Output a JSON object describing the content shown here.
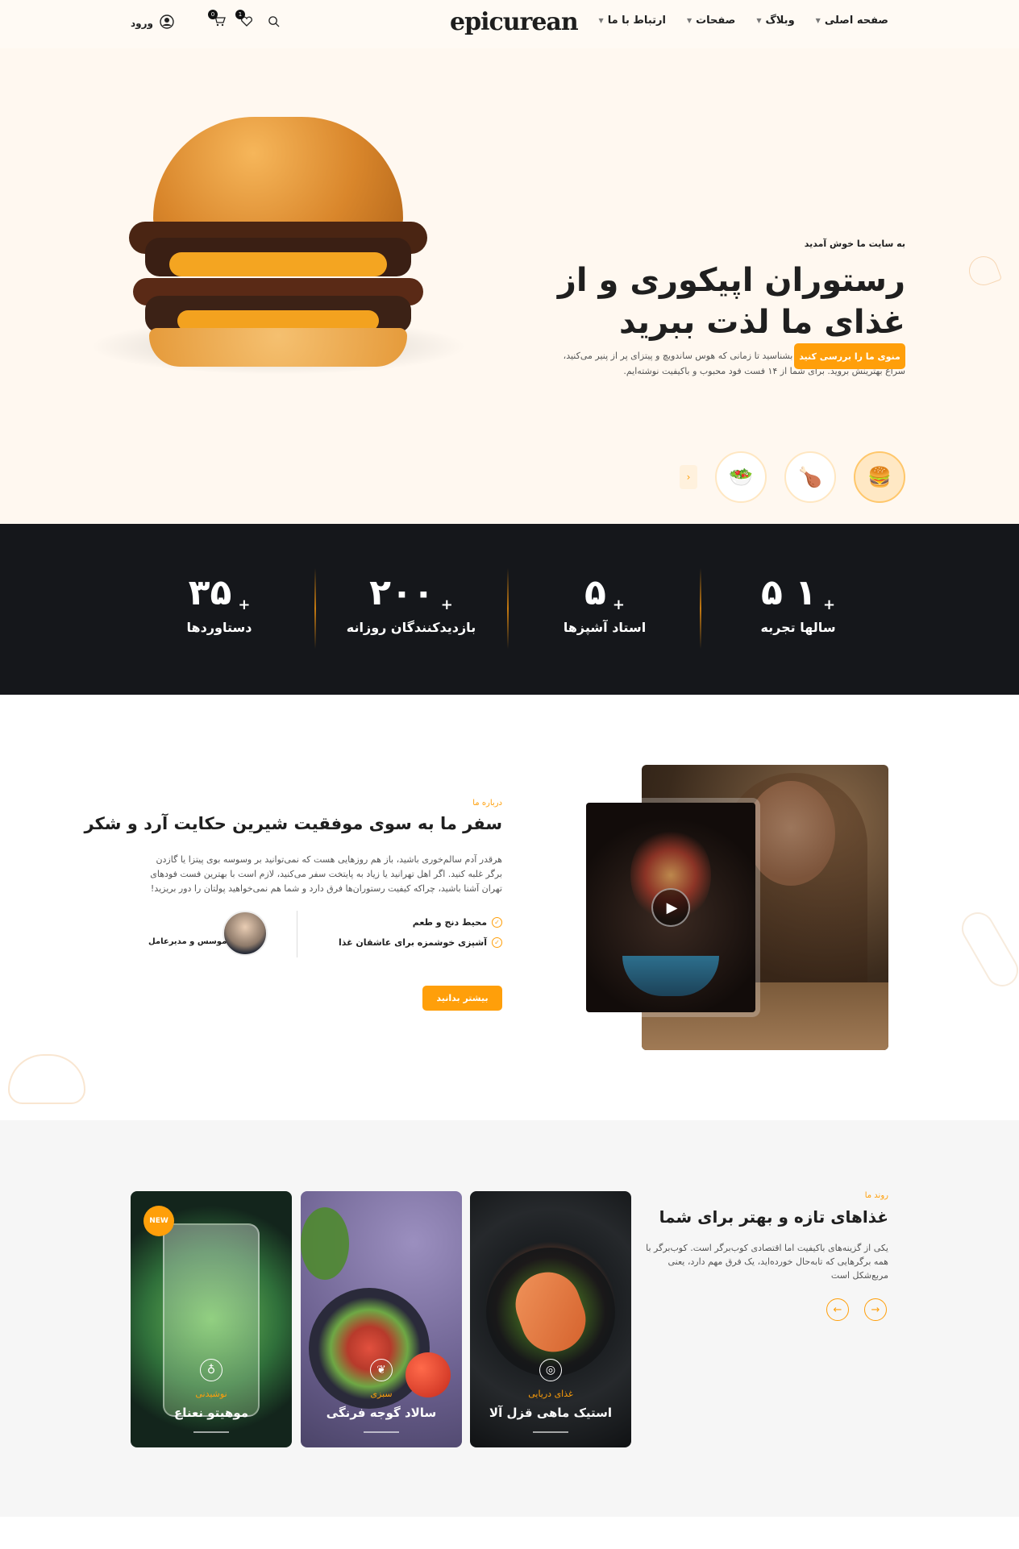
{
  "header": {
    "logo": "epicurean",
    "nav": [
      {
        "label": "صفحه اصلی"
      },
      {
        "label": "وبلاگ"
      },
      {
        "label": "صفحات"
      },
      {
        "label": "ارتباط با ما"
      }
    ],
    "cart_count": "0",
    "wishlist_count": "1",
    "login_label": "ورود"
  },
  "hero": {
    "subtitle": "به سایت ما خوش آمدید",
    "title": "رستوران اپیکوری و از غذای ما لذت ببرید",
    "description": "بهترین فست فودهای تهران را بشناسید تا زمانی که هوس ساندویچ و پیتزای پر از پنیر می‌کنید، سراغ بهترینش بروید. برای شما از ۱۴ فست فود محبوب و باکیفیت نوشته‌ایم.",
    "cta": "منوی ما را بررسی کنید"
  },
  "stats": [
    {
      "value": "۱ ۵",
      "label": "سالها تجربه"
    },
    {
      "value": "۵",
      "label": "استاد آشپزها"
    },
    {
      "value": "۲۰۰",
      "label": "بازدیدکنندگان روزانه"
    },
    {
      "value": "۳۵",
      "label": "دستاوردها"
    }
  ],
  "about": {
    "eyebrow": "درباره ما",
    "title": "سفر ما به سوی موفقیت شیرین حکایت آرد و شکر",
    "description": "هرقدر آدم سالم‌خوری باشید، باز هم روزهایی هست که نمی‌توانید بر وسوسه بوی پیتزا یا گازدن برگر غلبه کنید. اگر اهل تهرانید یا زیاد به پایتخت سفر می‌کنید، لازم است با بهترین فست فودهای تهران آشنا باشید، چراکه کیفیت رستوران‌ها فرق دارد و شما هم نمی‌خواهید پولتان را دور بریزید!",
    "features": [
      "محیط دنج و طعم",
      "آشپزی خوشمزه برای عاشقان غذا"
    ],
    "founder_role": "موسس و مدیرعامل",
    "cta": "بیشتر بدانید"
  },
  "menu": {
    "eyebrow": "روند ما",
    "title": "غذاهای تازه و بهتر برای شما",
    "description": "یکی از گزینه‌های باکیفیت اما اقتصادی کوب‌برگر است. کوب‌برگر با همه برگرهایی که تابه‌حال خورده‌اید، یک فرق مهم دارد، یعنی مربع‌شکل است",
    "cards": [
      {
        "category": "غذای دریایی",
        "name": "استیک ماهی قزل آلا"
      },
      {
        "category": "سبزی",
        "name": "سالاد گوجه فرنگی"
      },
      {
        "category": "نوشیدنی",
        "name": "موهیتو نعناع",
        "badge": "NEW"
      }
    ]
  },
  "colors": {
    "accent": "#ff9f0a",
    "dark": "#15171b",
    "cream": "#fff8f0"
  }
}
